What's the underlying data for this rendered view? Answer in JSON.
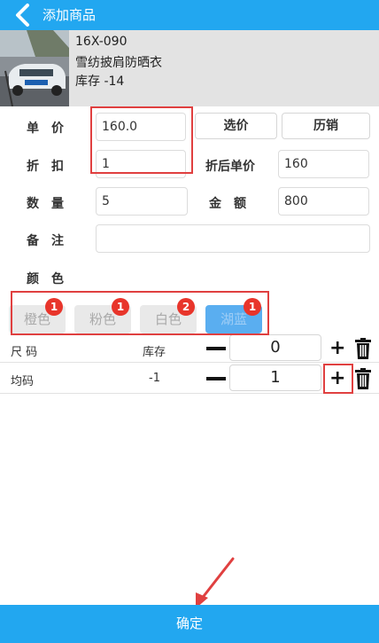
{
  "header": {
    "title": "添加商品",
    "back_icon": "chevron-left-icon"
  },
  "product": {
    "code": "16X-090",
    "name": "雪纺披肩防晒衣",
    "stock": "库存 -14"
  },
  "form": {
    "price_label": "单　价",
    "price_value": "160.0",
    "select_price_button": "选价",
    "history_sales_button": "历销",
    "discount_label": "折　扣",
    "discount_value": "1",
    "discounted_price_label": "折后单价",
    "discounted_price_value": "160",
    "quantity_label": "数　量",
    "quantity_value": "5",
    "amount_label": "金　额",
    "amount_value": "800",
    "remark_label": "备　注",
    "remark_value": "",
    "color_label": "颜　色"
  },
  "colors": [
    {
      "label": "橙色",
      "count": "1",
      "selected": false
    },
    {
      "label": "粉色",
      "count": "1",
      "selected": false
    },
    {
      "label": "白色",
      "count": "2",
      "selected": false
    },
    {
      "label": "湖蓝",
      "count": "1",
      "selected": true
    }
  ],
  "size_table": {
    "header": {
      "size": "尺 码",
      "stock": "库存",
      "qty": "0"
    },
    "rows": [
      {
        "size": "均码",
        "stock": "-1",
        "qty": "1"
      }
    ]
  },
  "footer": {
    "confirm": "确定"
  },
  "theme": {
    "accent": "#22a7f0",
    "badge": "#e8352b",
    "highlight": "#e04040"
  }
}
